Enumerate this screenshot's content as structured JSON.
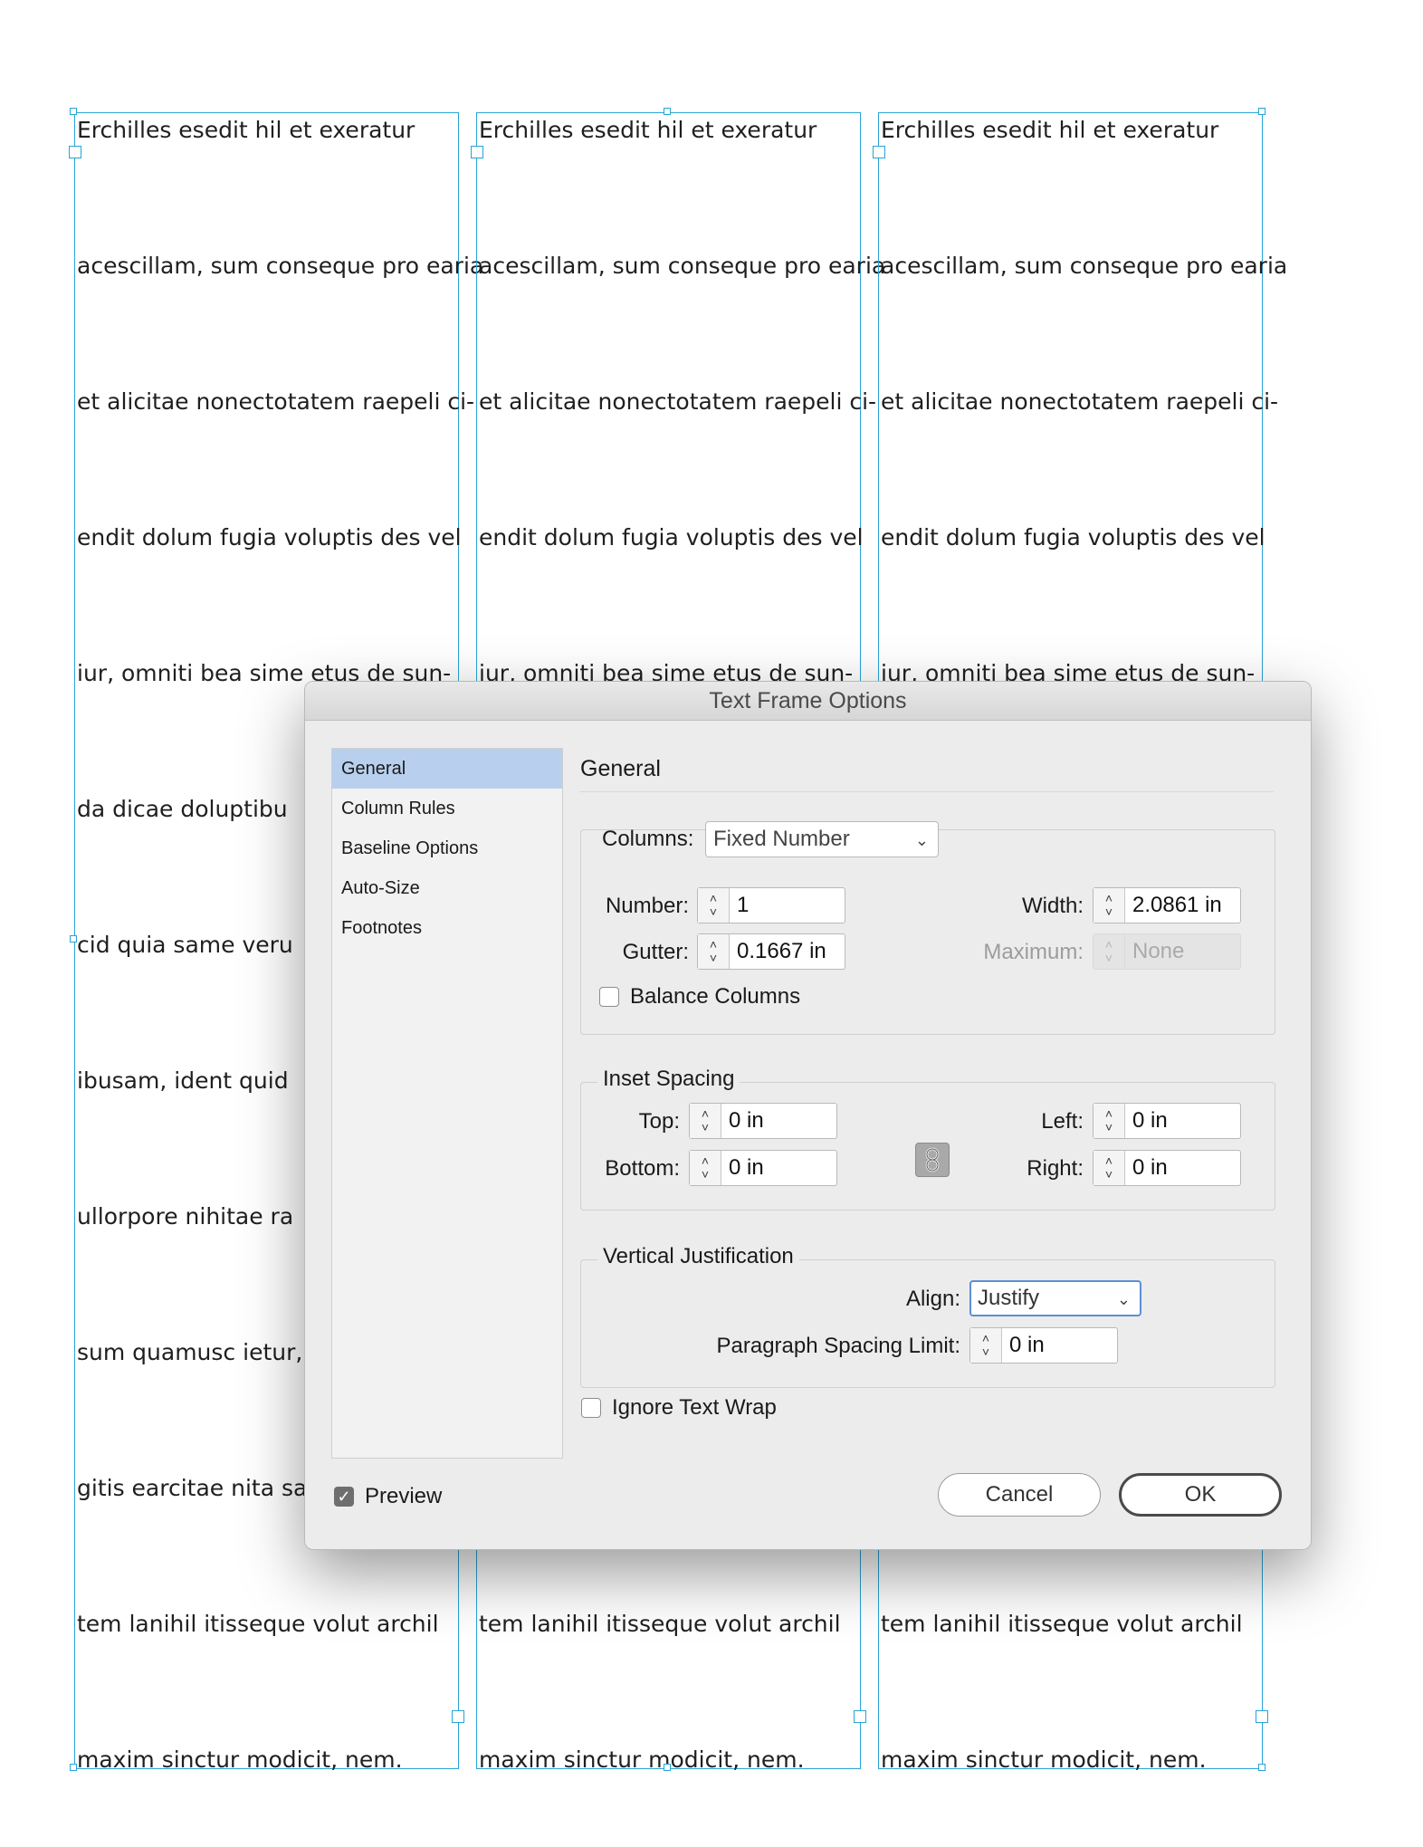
{
  "document": {
    "frames": [
      {
        "lines": [
          "Erchilles esedit hil et exeratur",
          "acescillam, sum conseque pro earia",
          "et alicitae nonectotatem raepeli ci-",
          "endit dolum fugia voluptis des vel",
          "iur, omniti bea sime etus de sun-",
          "da dicae doluptibu",
          "cid quia same veru",
          "ibusam, ident quid",
          "ullorpore nihitae ra",
          "sum quamusc ietur,",
          "gitis earcitae nita san",
          "tem lanihil itisseque volut archil",
          "maxim sinctur modicit, nem."
        ]
      },
      {
        "lines": [
          "Erchilles esedit hil et exeratur",
          "acescillam, sum conseque pro earia",
          "et alicitae nonectotatem raepeli ci-",
          "endit dolum fugia voluptis des vel",
          "iur, omniti bea sime etus de sun-",
          "",
          "",
          "",
          "",
          "",
          "",
          "tem lanihil itisseque volut archil",
          "maxim sinctur modicit, nem."
        ]
      },
      {
        "lines": [
          "Erchilles esedit hil et exeratur",
          "acescillam, sum conseque pro earia",
          "et alicitae nonectotatem raepeli ci-",
          "endit dolum fugia voluptis des vel",
          "iur, omniti bea sime etus de sun-",
          "",
          "",
          "",
          "",
          "",
          "",
          "tem lanihil itisseque volut archil",
          "maxim sinctur modicit, nem."
        ]
      }
    ]
  },
  "dialog": {
    "title": "Text Frame Options",
    "sidebar": [
      "General",
      "Column Rules",
      "Baseline Options",
      "Auto-Size",
      "Footnotes"
    ],
    "panel_title": "General",
    "columns": {
      "label": "Columns:",
      "type": "Fixed Number",
      "number_label": "Number:",
      "number": "1",
      "gutter_label": "Gutter:",
      "gutter": "0.1667 in",
      "width_label": "Width:",
      "width": "2.0861 in",
      "maximum_label": "Maximum:",
      "maximum": "None",
      "balance_label": "Balance Columns"
    },
    "inset": {
      "legend": "Inset Spacing",
      "top_label": "Top:",
      "top": "0 in",
      "bottom_label": "Bottom:",
      "bottom": "0 in",
      "left_label": "Left:",
      "left": "0 in",
      "right_label": "Right:",
      "right": "0 in"
    },
    "vertical": {
      "legend": "Vertical Justification",
      "align_label": "Align:",
      "align": "Justify",
      "psl_label": "Paragraph Spacing Limit:",
      "psl": "0 in"
    },
    "ignore_wrap_label": "Ignore Text Wrap",
    "preview_label": "Preview",
    "cancel": "Cancel",
    "ok": "OK"
  },
  "colors": {
    "frame_border": "#29a3d6",
    "sidebar_selected": "#b8d0ee"
  }
}
